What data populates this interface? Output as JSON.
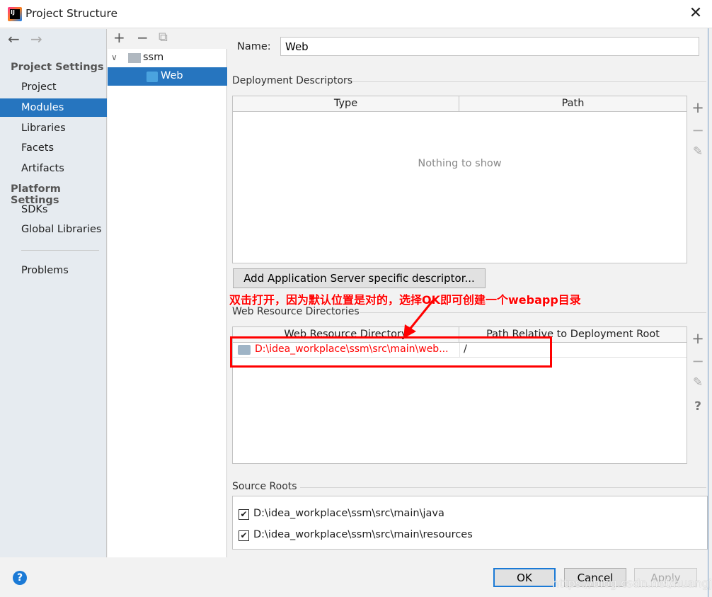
{
  "window": {
    "title": "Project Structure",
    "close_icon": "close-icon"
  },
  "nav": {
    "back": "←",
    "forward": "→"
  },
  "sidebar": {
    "project_settings_header": "Project Settings",
    "platform_settings_header": "Platform Settings",
    "items": [
      {
        "label": "Project"
      },
      {
        "label": "Modules",
        "selected": true
      },
      {
        "label": "Libraries"
      },
      {
        "label": "Facets"
      },
      {
        "label": "Artifacts"
      }
    ],
    "platform_items": [
      {
        "label": "SDKs"
      },
      {
        "label": "Global Libraries"
      }
    ],
    "problems": "Problems"
  },
  "tree": {
    "toolbar": {
      "add": "+",
      "remove": "−",
      "copy": "⧉"
    },
    "nodes": [
      {
        "label": "ssm",
        "expanded": true
      },
      {
        "label": "Web",
        "selected": true
      }
    ]
  },
  "facet": {
    "name_label": "Name:",
    "name_value": "Web",
    "deployment_descriptors": {
      "title": "Deployment Descriptors",
      "columns": [
        "Type",
        "Path"
      ],
      "empty_text": "Nothing to show"
    },
    "add_descriptor_button": "Add Application Server specific descriptor...",
    "web_resource_dirs": {
      "title": "Web Resource Directories",
      "columns": [
        "Web Resource Directory",
        "Path Relative to Deployment Root"
      ],
      "rows": [
        {
          "directory": "D:\\idea_workplace\\ssm\\src\\main\\web...",
          "path": "/"
        }
      ]
    },
    "source_roots": {
      "title": "Source Roots",
      "items": [
        {
          "path": "D:\\idea_workplace\\ssm\\src\\main\\java",
          "checked": true
        },
        {
          "path": "D:\\idea_workplace\\ssm\\src\\main\\resources",
          "checked": true
        }
      ]
    }
  },
  "annotation": {
    "text": "双击打开，因为默认位置是对的，选择OK即可创建一个webapp目录",
    "color": "#ff0000"
  },
  "buttons": {
    "ok": "OK",
    "cancel": "Cancel",
    "apply": "Apply"
  },
  "watermark": "https://blog.csdn.net/huangjhai",
  "colors": {
    "selection": "#2675bf",
    "accent": "#1b7ad6"
  }
}
